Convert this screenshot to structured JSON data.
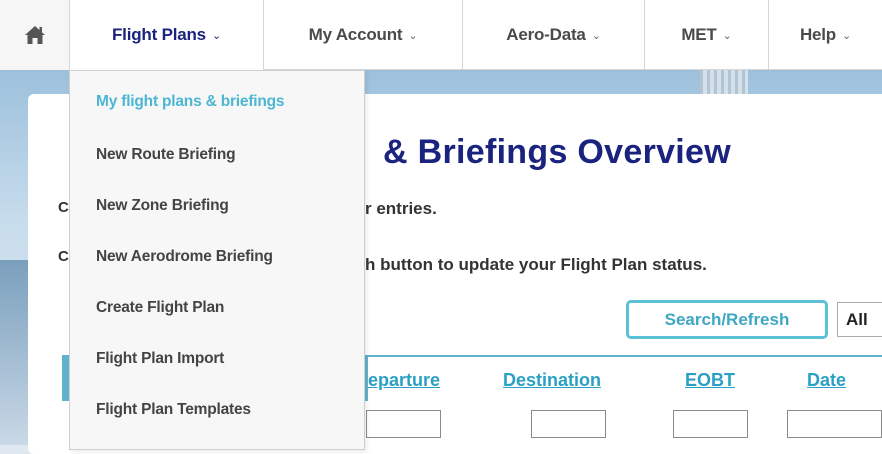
{
  "nav": {
    "items": [
      {
        "label": "Flight Plans",
        "chevron": "⌄",
        "active": true
      },
      {
        "label": "My Account",
        "chevron": "⌄"
      },
      {
        "label": "Aero-Data",
        "chevron": "⌄"
      },
      {
        "label": "MET",
        "chevron": "⌄"
      },
      {
        "label": "Help",
        "chevron": "⌄"
      }
    ],
    "home_icon": "home-icon"
  },
  "dropdown": {
    "items": [
      {
        "label": "My flight plans & briefings",
        "active": true
      },
      {
        "label": "New Route Briefing"
      },
      {
        "label": "New Zone Briefing"
      },
      {
        "label": "New Aerodrome Briefing"
      },
      {
        "label": "Create Flight Plan"
      },
      {
        "label": "Flight Plan Import"
      },
      {
        "label": "Flight Plan Templates"
      }
    ]
  },
  "main": {
    "title_fragment": "& Briefings Overview",
    "line1_left": "C",
    "line1_right": "r entries.",
    "line2_left": "C",
    "line2_right": "h button to update your Flight Plan status.",
    "search_button": "Search/Refresh",
    "filter_value": "All",
    "columns": [
      "eparture",
      "Destination",
      "EOBT",
      "Date"
    ]
  },
  "colors": {
    "accent": "#4cb6d3",
    "title": "#1a237e",
    "header_bar": "#5fb3cf"
  }
}
